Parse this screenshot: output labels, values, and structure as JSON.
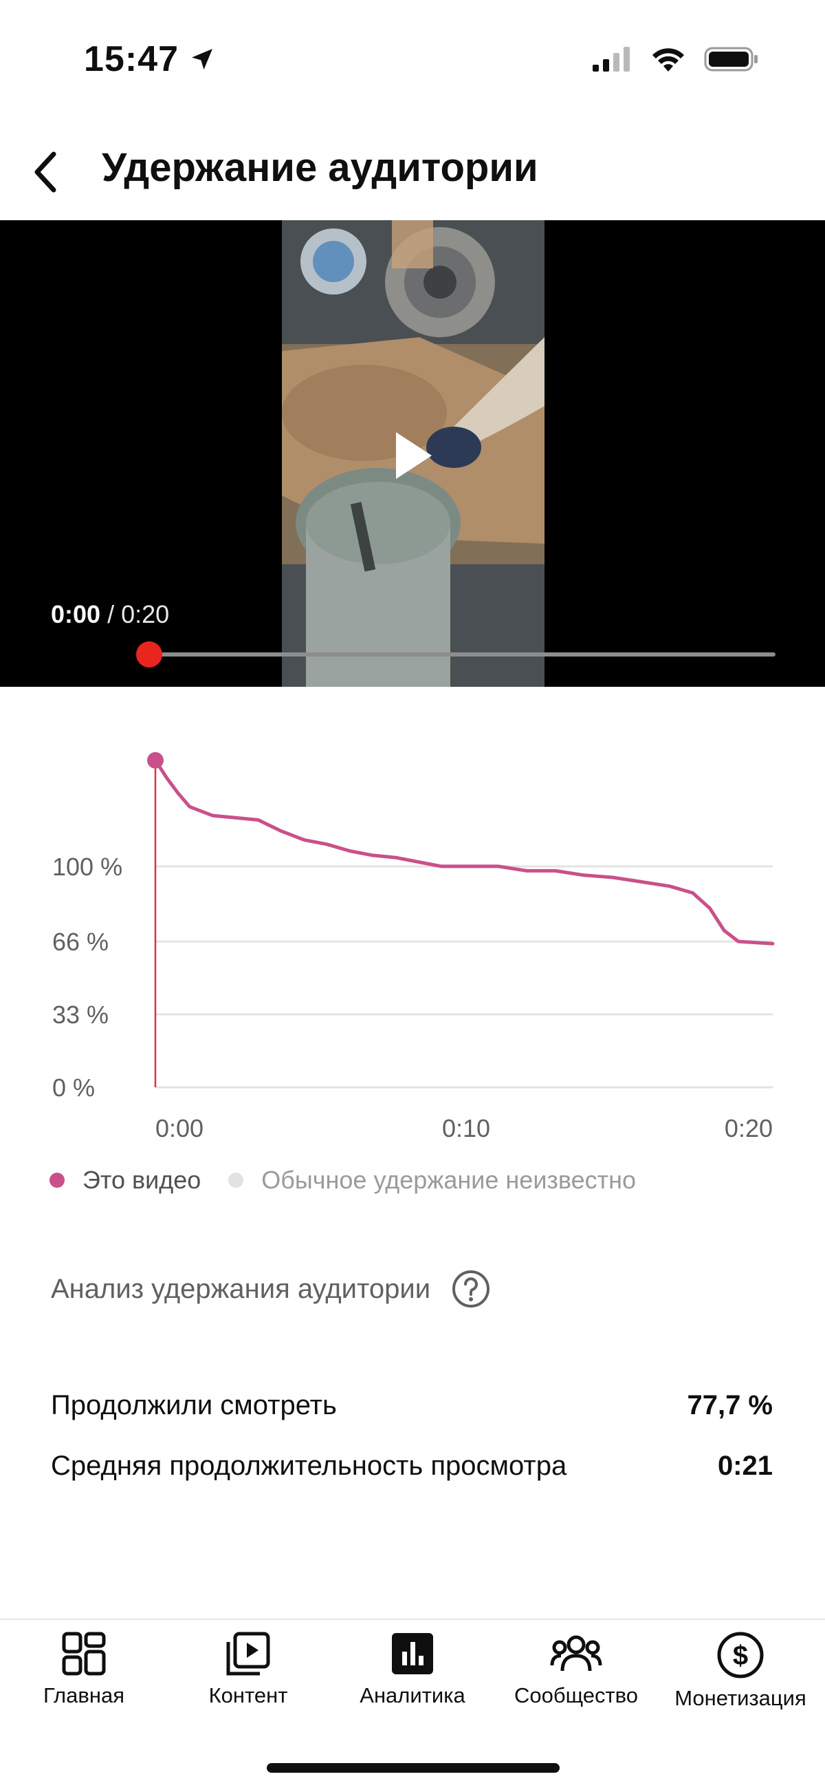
{
  "status_bar": {
    "time": "15:47"
  },
  "header": {
    "title": "Удержание аудитории"
  },
  "video": {
    "current_time": "0:00",
    "duration": " / 0:20",
    "progress": 0
  },
  "chart_data": {
    "type": "line",
    "x_ticks": [
      "0:00",
      "0:10",
      "0:20"
    ],
    "y_ticks": [
      "100 %",
      "66 %",
      "33 %",
      "0 %"
    ],
    "y_tick_values": [
      100,
      66,
      33,
      0
    ],
    "xlim": [
      0,
      21.6
    ],
    "ylim": [
      0,
      152
    ],
    "series": [
      {
        "name": "Это видео",
        "color": "#c9508a",
        "x": [
          0,
          0.4,
          0.8,
          1.2,
          2.0,
          2.8,
          3.6,
          4.4,
          5.2,
          6.0,
          6.8,
          7.6,
          8.4,
          9.2,
          10.0,
          11.0,
          12.0,
          13.0,
          14.0,
          15.0,
          16.0,
          17.0,
          18.0,
          18.8,
          19.4,
          19.9,
          20.4,
          21.6
        ],
        "y": [
          148,
          140,
          133,
          127,
          123,
          122,
          121,
          116,
          112,
          110,
          107,
          105,
          104,
          102,
          100,
          100,
          100,
          98,
          98,
          96,
          95,
          93,
          91,
          88,
          81,
          71,
          66,
          65
        ]
      }
    ],
    "legend": [
      {
        "label": "Это видео",
        "color": "#c9508a"
      },
      {
        "label": "Обычное удержание неизвестно",
        "color": "#e2e2e2"
      }
    ]
  },
  "analysis": {
    "title": "Анализ удержания аудитории",
    "stats": [
      {
        "label": "Продолжили смотреть",
        "value": "77,7 %"
      },
      {
        "label": "Средняя продолжительность просмотра",
        "value": "0:21"
      }
    ]
  },
  "nav": {
    "items": [
      {
        "label": "Главная",
        "icon": "grid-icon"
      },
      {
        "label": "Контент",
        "icon": "content-icon"
      },
      {
        "label": "Аналитика",
        "icon": "analytics-icon"
      },
      {
        "label": "Сообщество",
        "icon": "community-icon"
      },
      {
        "label": "Монетизация",
        "icon": "dollar-icon"
      }
    ]
  }
}
